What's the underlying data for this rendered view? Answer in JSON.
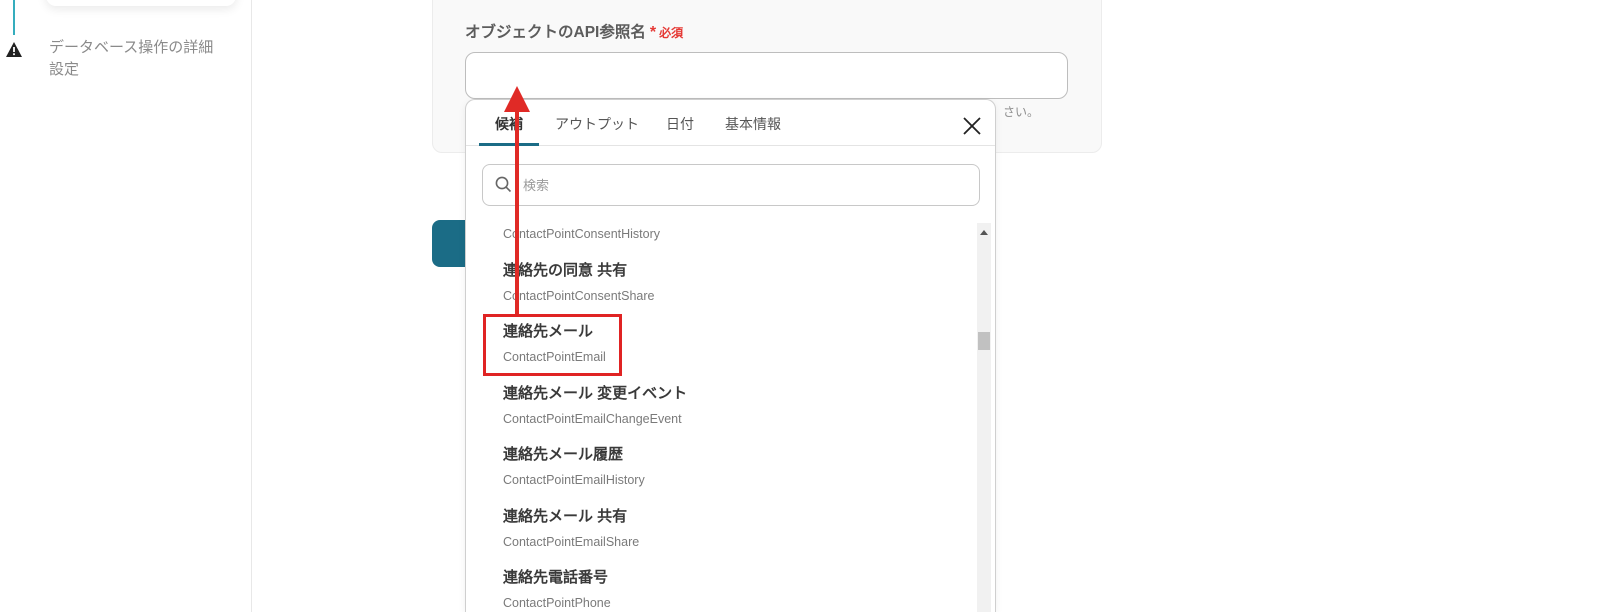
{
  "sidebar": {
    "step_label": "データベース操作の詳細設定",
    "step_status_icon": "warning-icon"
  },
  "form": {
    "field_label": "オブジェクトのAPI参照名",
    "required_mark": "*",
    "required_text": "必須",
    "input_value": "",
    "hint_text_visible": "さい。"
  },
  "dropdown": {
    "tabs": [
      {
        "label": "候補",
        "active": true
      },
      {
        "label": "アウトプット",
        "active": false
      },
      {
        "label": "日付",
        "active": false
      },
      {
        "label": "基本情報",
        "active": false
      }
    ],
    "close_icon": "close-icon",
    "search": {
      "placeholder": "検索",
      "value": "",
      "icon": "search-icon"
    },
    "items": [
      {
        "api_name": "ContactPointConsentHistory"
      },
      {
        "label": "連絡先の同意 共有",
        "api_name": "ContactPointConsentShare"
      },
      {
        "label": "連絡先メール",
        "api_name": "ContactPointEmail",
        "highlighted": true
      },
      {
        "label": "連絡先メール 変更イベント",
        "api_name": "ContactPointEmailChangeEvent"
      },
      {
        "label": "連絡先メール履歴",
        "api_name": "ContactPointEmailHistory"
      },
      {
        "label": "連絡先メール 共有",
        "api_name": "ContactPointEmailShare"
      },
      {
        "label": "連絡先電話番号",
        "api_name": "ContactPointPhone"
      }
    ]
  },
  "colors": {
    "accent": "#1b6c86",
    "required": "#e53935",
    "annotation": "#e02323",
    "step_line": "#35adbd"
  }
}
